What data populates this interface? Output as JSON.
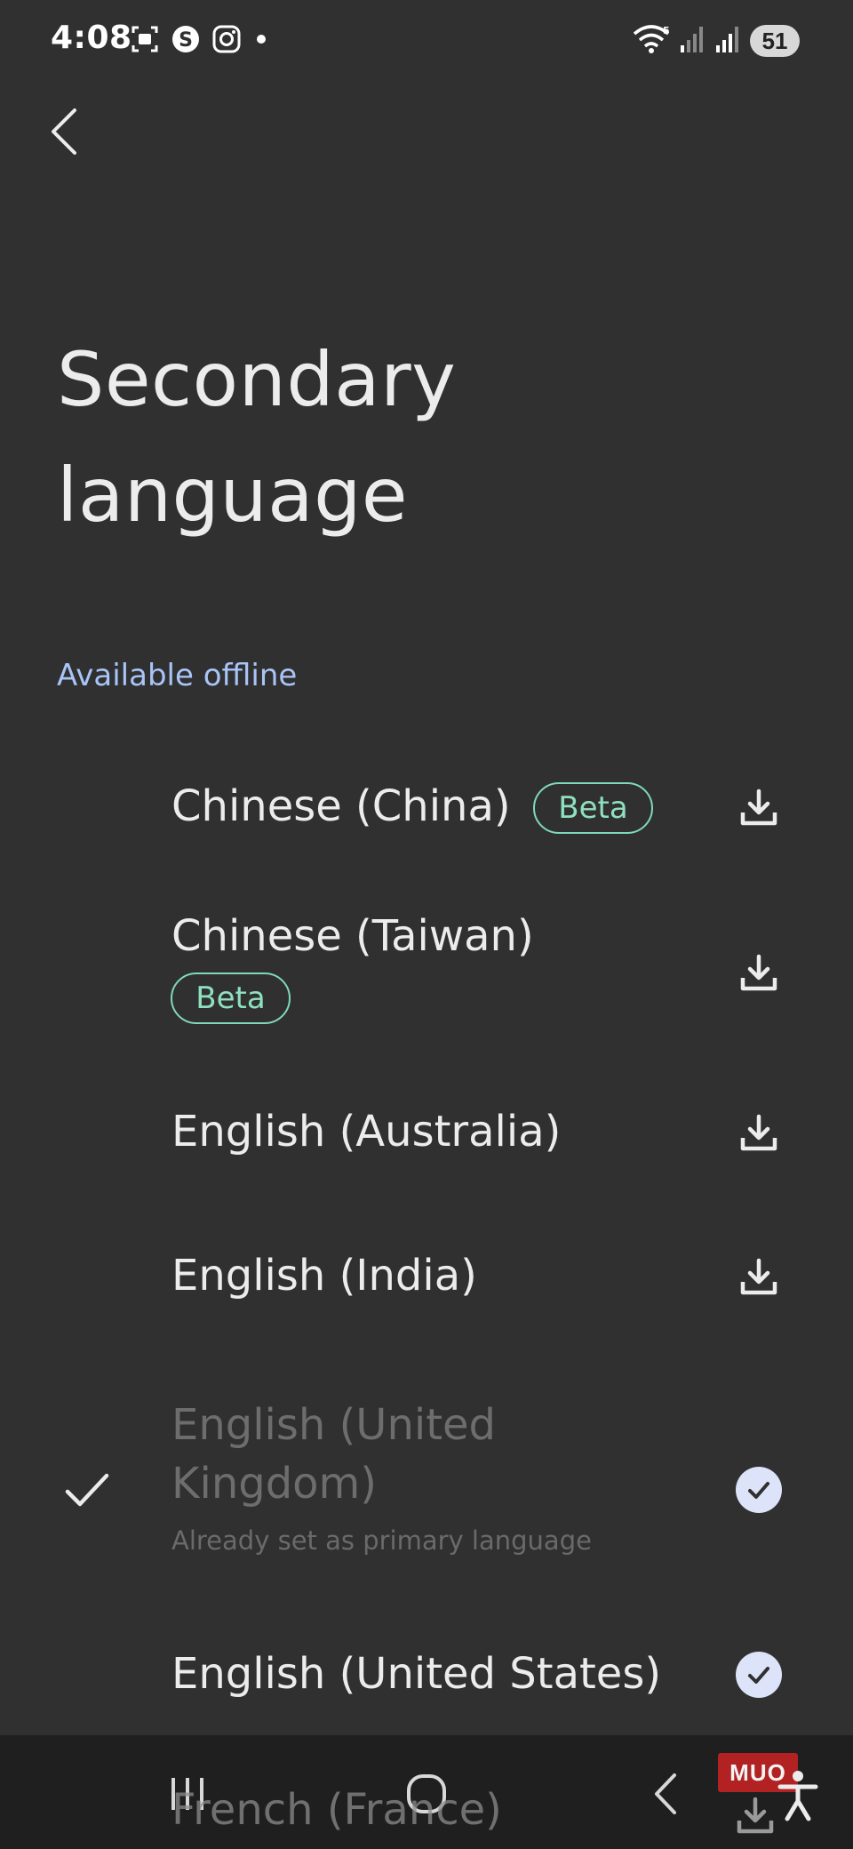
{
  "status_bar": {
    "time": "4:08",
    "battery": "51",
    "left_icons": [
      "screenshot-icon",
      "sync-icon",
      "instagram-icon",
      "notification-dot-icon"
    ],
    "right_icons": [
      "wifi-icon",
      "signal-icon",
      "signal-icon-2"
    ]
  },
  "header": {
    "back_icon": "chevron-left-icon"
  },
  "page": {
    "title_line1": "Secondary",
    "title_line2": "language",
    "section_header": "Available offline"
  },
  "languages": [
    {
      "label": "Chinese (China)",
      "badge": "Beta",
      "action": "download-icon"
    },
    {
      "label": "Chinese (Taiwan)",
      "badge": "Beta",
      "action": "download-icon"
    },
    {
      "label": "English (Australia)",
      "badge": "",
      "action": "download-icon"
    },
    {
      "label": "English (India)",
      "badge": "",
      "action": "download-icon"
    },
    {
      "label_line1": "English (United",
      "label_line2": "Kingdom)",
      "sub": "Already set as primary language",
      "action": "check-circle-icon",
      "selected": true
    },
    {
      "label": "English (United States)",
      "badge": "",
      "action": "check-circle-icon"
    },
    {
      "label": "French (France)",
      "badge": "",
      "action": "download-icon"
    }
  ],
  "nav_bar": {
    "recents_icon": "recents-icon",
    "home_icon": "home-icon",
    "back_icon": "back-icon"
  },
  "watermark": {
    "text": "MUO"
  },
  "colors": {
    "background": "#303030",
    "accent_blue": "#a9c4f7",
    "beta_green": "#7fd9b8",
    "check_circle": "#dde3f8"
  }
}
